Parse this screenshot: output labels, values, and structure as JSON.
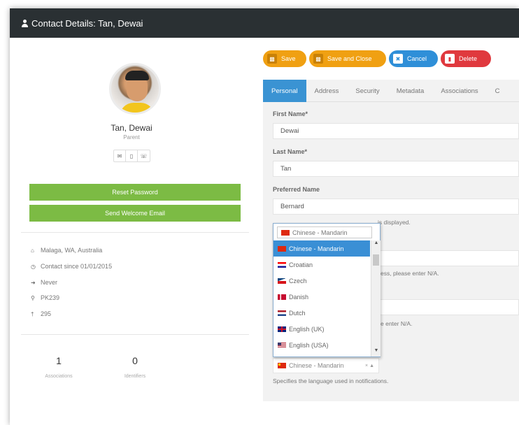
{
  "window": {
    "title": "Contact Details: Tan, Dewai"
  },
  "profile": {
    "name": "Tan, Dewai",
    "role": "Parent",
    "reset_password": "Reset Password",
    "send_welcome": "Send Welcome Email"
  },
  "info": {
    "location": "Malaga, WA, Australia",
    "since": "Contact since 01/01/2015",
    "last_login": "Never",
    "key": "PK239",
    "id": "295"
  },
  "stats": [
    {
      "value": "1",
      "label": "Associations"
    },
    {
      "value": "0",
      "label": "Identifiers"
    }
  ],
  "toolbar": {
    "save": "Save",
    "save_close": "Save and Close",
    "cancel": "Cancel",
    "delete": "Delete"
  },
  "tabs": [
    "Personal",
    "Address",
    "Security",
    "Metadata",
    "Associations",
    "C"
  ],
  "form": {
    "first_name_label": "First Name*",
    "first_name_value": "Dewai",
    "last_name_label": "Last Name*",
    "last_name_value": "Tan",
    "preferred_label": "Preferred Name",
    "preferred_value": "Bernard",
    "preferred_help_tail": "is displayed.",
    "help2_tail": "ess, please enter N/A.",
    "help3_tail": "e enter N/A.",
    "language_value": "Chinese - Mandarin",
    "language_help": "Specifies the language used in notifications."
  },
  "dropdown": {
    "search_value": "Chinese - Mandarin",
    "options": [
      {
        "label": "Chinese - Mandarin",
        "flag": "flag-cn",
        "selected": true
      },
      {
        "label": "Croatian",
        "flag": "flag-hr"
      },
      {
        "label": "Czech",
        "flag": "flag-cz"
      },
      {
        "label": "Danish",
        "flag": "flag-dk"
      },
      {
        "label": "Dutch",
        "flag": "flag-nl"
      },
      {
        "label": "English (UK)",
        "flag": "flag-uk"
      },
      {
        "label": "English (USA)",
        "flag": "flag-us"
      }
    ]
  },
  "colors": {
    "titlebar": "#2a3033",
    "green": "#7cbb44",
    "orange": "#f0a012",
    "blue": "#2f8fd8",
    "red": "#e0393e",
    "tab_active": "#3a93d3"
  }
}
